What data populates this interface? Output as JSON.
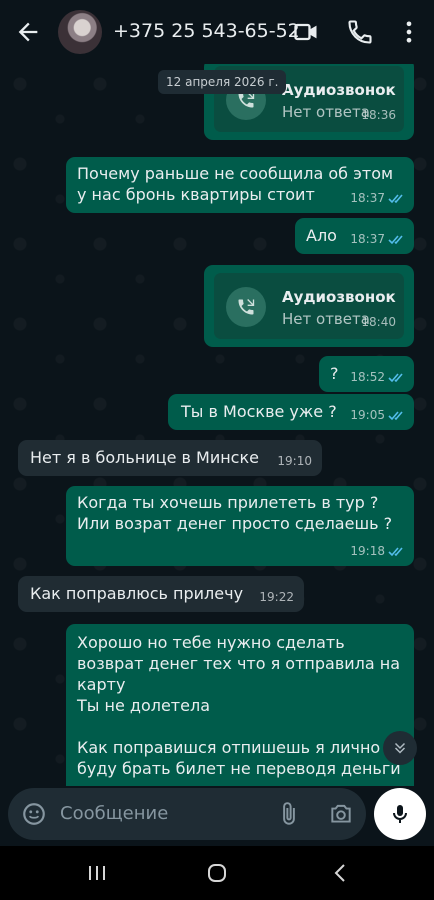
{
  "header": {
    "contact_name": "+375 25 543-65-52",
    "icons": [
      "back-arrow-icon",
      "video-call-icon",
      "phone-icon",
      "more-vert-icon"
    ]
  },
  "date_chip": "12 апреля 2026 г.",
  "messages": [
    {
      "type": "call",
      "direction": "out",
      "title": "Аудиозвонок",
      "subtitle": "Нет ответа",
      "time": "18:36"
    },
    {
      "type": "text",
      "direction": "out",
      "text": "Почему раньше не сообщила об этом\nу нас бронь квартиры стоит",
      "time": "18:37",
      "read": true
    },
    {
      "type": "text",
      "direction": "out",
      "text": "Ало",
      "time": "18:37",
      "read": true
    },
    {
      "type": "call",
      "direction": "out",
      "title": "Аудиозвонок",
      "subtitle": "Нет ответа",
      "time": "18:40"
    },
    {
      "type": "text",
      "direction": "out",
      "text": "?",
      "time": "18:52",
      "read": true
    },
    {
      "type": "text",
      "direction": "out",
      "text": "Ты в Москве уже ?",
      "time": "19:05",
      "read": true
    },
    {
      "type": "text",
      "direction": "in",
      "text": "Нет я в больнице в Минске",
      "time": "19:10"
    },
    {
      "type": "text",
      "direction": "out",
      "text": "Когда ты хочешь прилететь в тур ?\nИли возрат денег просто сделаешь ?",
      "time": "19:18",
      "read": true
    },
    {
      "type": "text",
      "direction": "in",
      "text": "Как поправлюсь прилечу",
      "time": "19:22"
    },
    {
      "type": "text",
      "direction": "out",
      "text": "Хорошо но тебе нужно сделать\nвозврат денег тех что я отправила на\nкарту\nТы не долетела\n\nКак поправишся отпишешь я лично\nбуду брать билет не переводя деньги"
    }
  ],
  "input": {
    "placeholder": "Сообщение",
    "icons": [
      "emoji-icon",
      "attach-icon",
      "camera-icon",
      "mic-icon"
    ]
  },
  "colors": {
    "background": "#0b141a",
    "outgoing_bubble": "#005c4b",
    "incoming_bubble": "#202c33",
    "read_ticks": "#53bdeb"
  }
}
